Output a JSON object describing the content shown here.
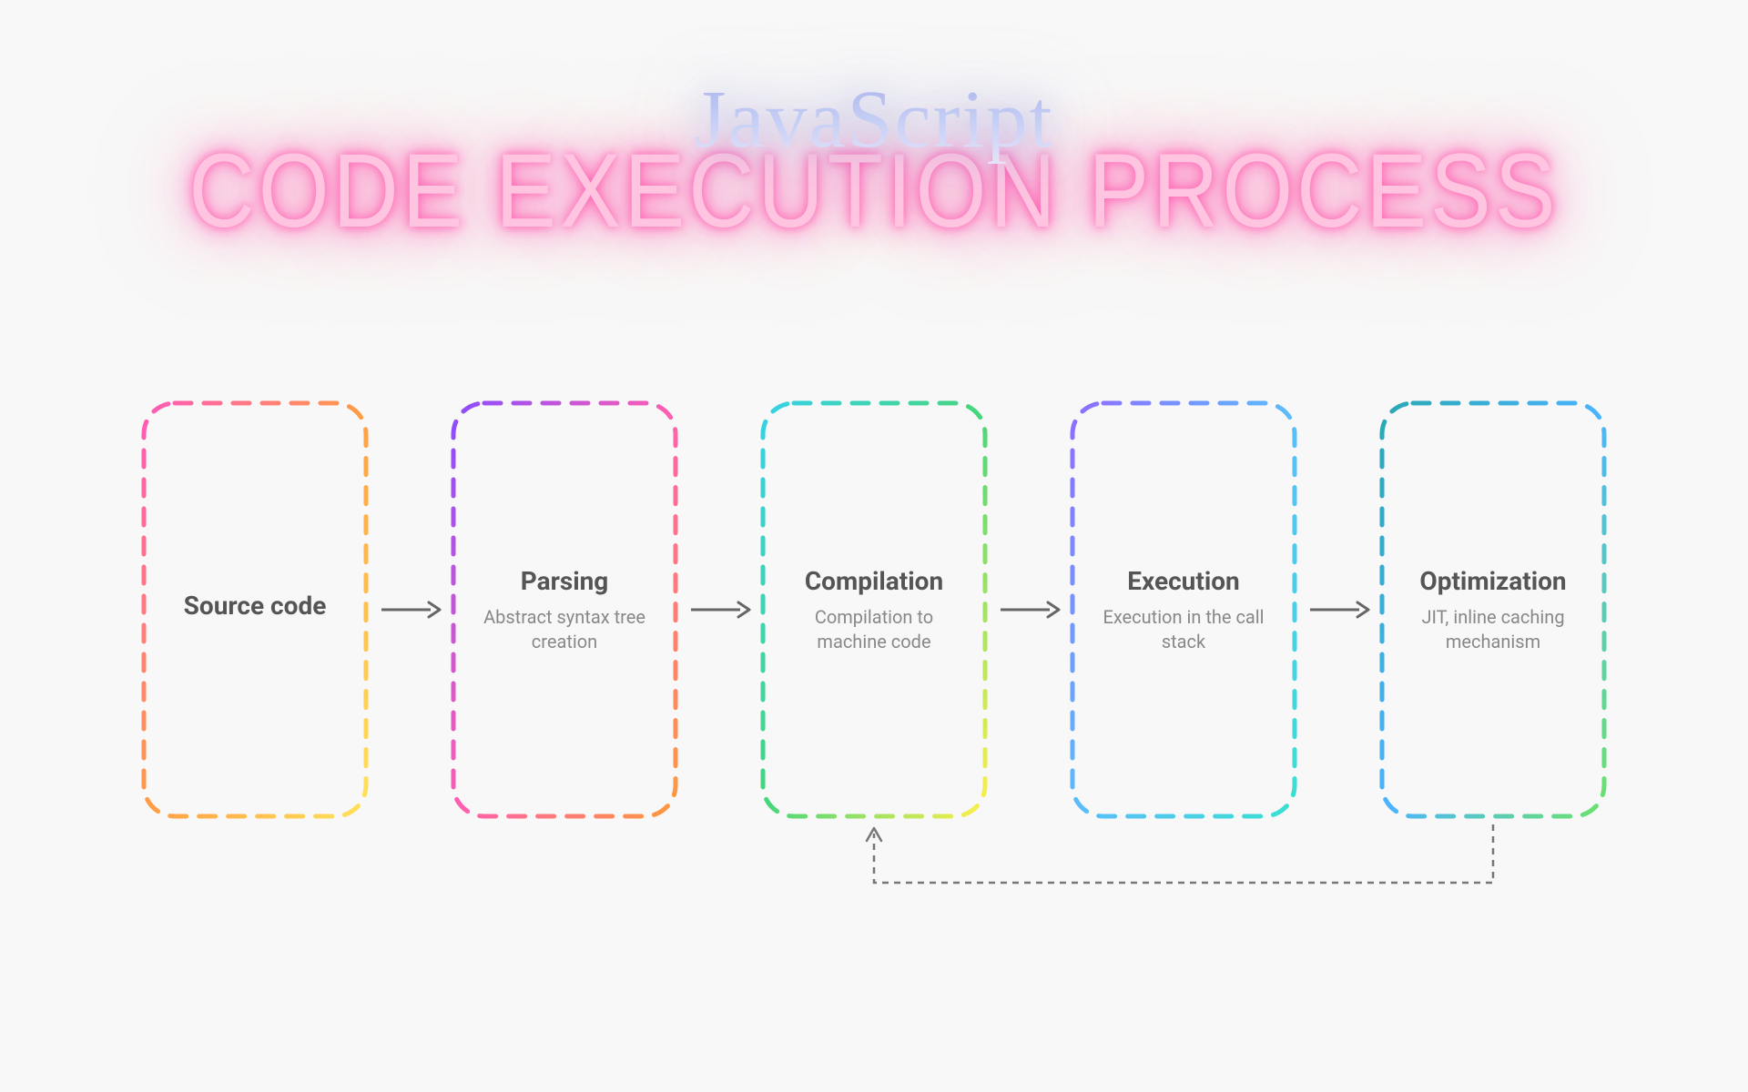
{
  "header": {
    "script_title": "JavaScript",
    "main_title": "CODE EXECUTION PROCESS"
  },
  "steps": [
    {
      "title": "Source code",
      "desc": "",
      "gradient": [
        "#ff59b9",
        "#ff9d45",
        "#ffe35a"
      ]
    },
    {
      "title": "Parsing",
      "desc": "Abstract syntax tree creation",
      "gradient": [
        "#8a4cff",
        "#ff5fb0",
        "#ff9a3c"
      ]
    },
    {
      "title": "Compilation",
      "desc": "Compilation to machine code",
      "gradient": [
        "#36d1e8",
        "#46d67b",
        "#fff04a"
      ]
    },
    {
      "title": "Execution",
      "desc": "Execution in the call stack",
      "gradient": [
        "#8f6cff",
        "#5bbdfb",
        "#3ae0d1"
      ]
    },
    {
      "title": "Optimization",
      "desc": "JIT, inline caching mechanism",
      "gradient": [
        "#2aa8b3",
        "#4bb4ff",
        "#6be36a"
      ]
    }
  ],
  "feedback": {
    "from_step_index": 4,
    "to_step_index": 2
  }
}
